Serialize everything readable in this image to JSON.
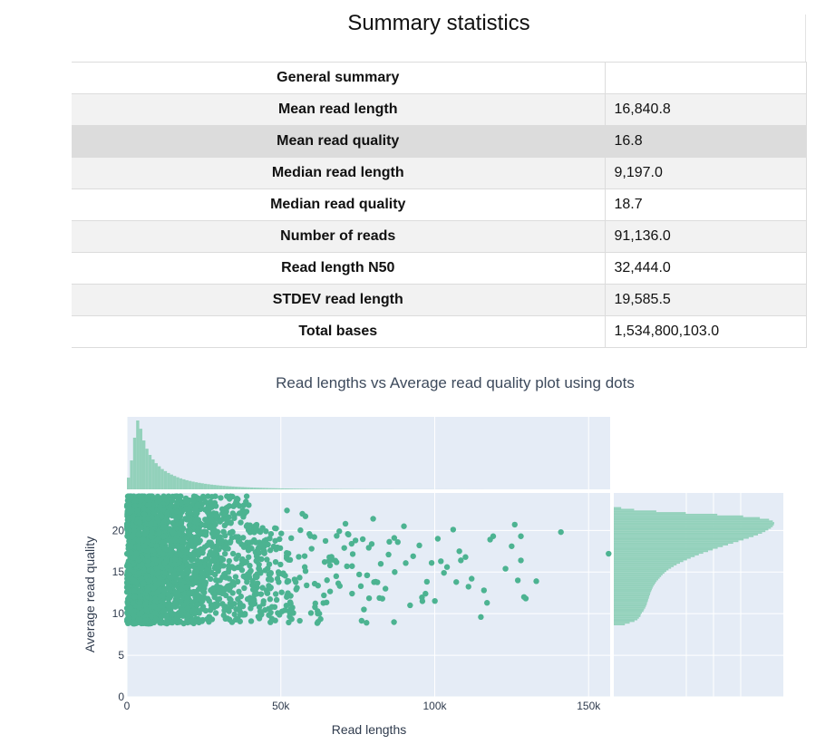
{
  "summary": {
    "title": "Summary statistics",
    "rows": [
      {
        "label": "General summary",
        "value": ""
      },
      {
        "label": "Mean read length",
        "value": "16,840.8"
      },
      {
        "label": "Mean read quality",
        "value": "16.8"
      },
      {
        "label": "Median read length",
        "value": "9,197.0"
      },
      {
        "label": "Median read quality",
        "value": "18.7"
      },
      {
        "label": "Number of reads",
        "value": "91,136.0"
      },
      {
        "label": "Read length N50",
        "value": "32,444.0"
      },
      {
        "label": "STDEV read length",
        "value": "19,585.5"
      },
      {
        "label": "Total bases",
        "value": "1,534,800,103.0"
      }
    ]
  },
  "chart_data": {
    "type": "scatter",
    "title": "Read lengths vs Average read quality plot using dots",
    "xlabel": "Read lengths",
    "ylabel": "Average read quality",
    "xlim": [
      0,
      157000
    ],
    "ylim": [
      0,
      24.5
    ],
    "x_ticks": [
      0,
      50000,
      100000,
      150000
    ],
    "x_tick_labels": [
      "0",
      "50k",
      "100k",
      "150k"
    ],
    "y_ticks": [
      0,
      5,
      10,
      15,
      20
    ],
    "y_tick_labels": [
      "0",
      "5",
      "10",
      "15",
      "20"
    ],
    "grid": true,
    "colors": {
      "marker": "#4cb391",
      "histogram": "#93d1bb",
      "background": "#e5ecf6"
    },
    "series": [
      {
        "marker": "dot",
        "x": [
          141000,
          156500,
          133000,
          127000,
          128000,
          126000,
          128000,
          125000,
          129000,
          117000,
          123000,
          115000,
          119000,
          110000,
          112000,
          118000,
          116000,
          104000,
          107000,
          106000,
          108000,
          101000,
          103000,
          97000,
          99000,
          95000,
          92000,
          90000,
          87000,
          84000,
          80000,
          77000,
          72000,
          68000,
          64000,
          60000,
          57000,
          93000,
          88000,
          83000,
          76000,
          71000,
          66000,
          62000,
          58000,
          55000,
          85000,
          78000,
          73000,
          96000,
          102000,
          69000,
          61000,
          52000,
          48000,
          45000,
          42000,
          40000,
          38000,
          36000
        ],
        "y": [
          19.8,
          17.2,
          13.9,
          14.0,
          16.4,
          20.7,
          19.3,
          18.1,
          12.0,
          11.3,
          15.4,
          9.6,
          19.3,
          16.8,
          14.2,
          18.9,
          12.8,
          15.6,
          13.8,
          20.1,
          17.5,
          19.0,
          14.9,
          12.4,
          16.1,
          18.2,
          11.0,
          20.5,
          15.0,
          13.0,
          21.4,
          10.5,
          19.5,
          14.5,
          12.2,
          17.8,
          22.0,
          16.9,
          18.6,
          11.8,
          13.3,
          20.8,
          15.8,
          10.0,
          21.7,
          12.9,
          17.1,
          14.6,
          18.4,
          11.5,
          16.3,
          19.9,
          13.6,
          22.4,
          10.8,
          15.2,
          20.4,
          11.9,
          18.0,
          9.4
        ]
      }
    ],
    "marginal_histograms": {
      "x": {
        "bin_width": 1000,
        "counts": [
          1700,
          4200,
          7500,
          10000,
          8800,
          7100,
          5900,
          5000,
          4350,
          3800,
          3350,
          2950,
          2650,
          2380,
          2150,
          1950,
          1760,
          1600,
          1460,
          1330,
          1220,
          1120,
          1030,
          950,
          880,
          810,
          750,
          690,
          640,
          590,
          550,
          510,
          470,
          440,
          410,
          380,
          355,
          330,
          310,
          290,
          270,
          252,
          235,
          220,
          206,
          193,
          181,
          170,
          160,
          150,
          140,
          131,
          123,
          116,
          109,
          102,
          96,
          90,
          85,
          80,
          75,
          70,
          66,
          62,
          58,
          55,
          52,
          49,
          46,
          43,
          40,
          38,
          36,
          34,
          32,
          30,
          28,
          26,
          25,
          23,
          22,
          21,
          20,
          19,
          18,
          17,
          16,
          15,
          14,
          13,
          12,
          11,
          11,
          10,
          10,
          9,
          9,
          8,
          8,
          7,
          7,
          6,
          6,
          6,
          5,
          5,
          5,
          4,
          4,
          4,
          4,
          3,
          3,
          3,
          3,
          3,
          2,
          2,
          2,
          2,
          2,
          2,
          2,
          1,
          1,
          1,
          1,
          1,
          1,
          1,
          1,
          1,
          1,
          1,
          1,
          1,
          1,
          1,
          1,
          1,
          1,
          1,
          1,
          1,
          1,
          1,
          1,
          1,
          1,
          1,
          1,
          1,
          1,
          1
        ]
      },
      "y": {
        "bin_width": 0.2,
        "start": 8.6,
        "counts": [
          300,
          430,
          560,
          640,
          680,
          720,
          730,
          760,
          800,
          820,
          850,
          870,
          890,
          900,
          920,
          930,
          950,
          960,
          980,
          990,
          1010,
          1030,
          1050,
          1070,
          1100,
          1130,
          1160,
          1200,
          1240,
          1280,
          1320,
          1370,
          1420,
          1480,
          1550,
          1620,
          1700,
          1790,
          1880,
          1980,
          2080,
          2190,
          2300,
          2420,
          2550,
          2680,
          2810,
          2950,
          3090,
          3230,
          3370,
          3510,
          3650,
          3780,
          3900,
          4010,
          4100,
          4180,
          4250,
          4300,
          4330,
          4340,
          4300,
          4200,
          3950,
          3500,
          2800,
          1950,
          1150,
          550,
          200
        ]
      }
    }
  }
}
